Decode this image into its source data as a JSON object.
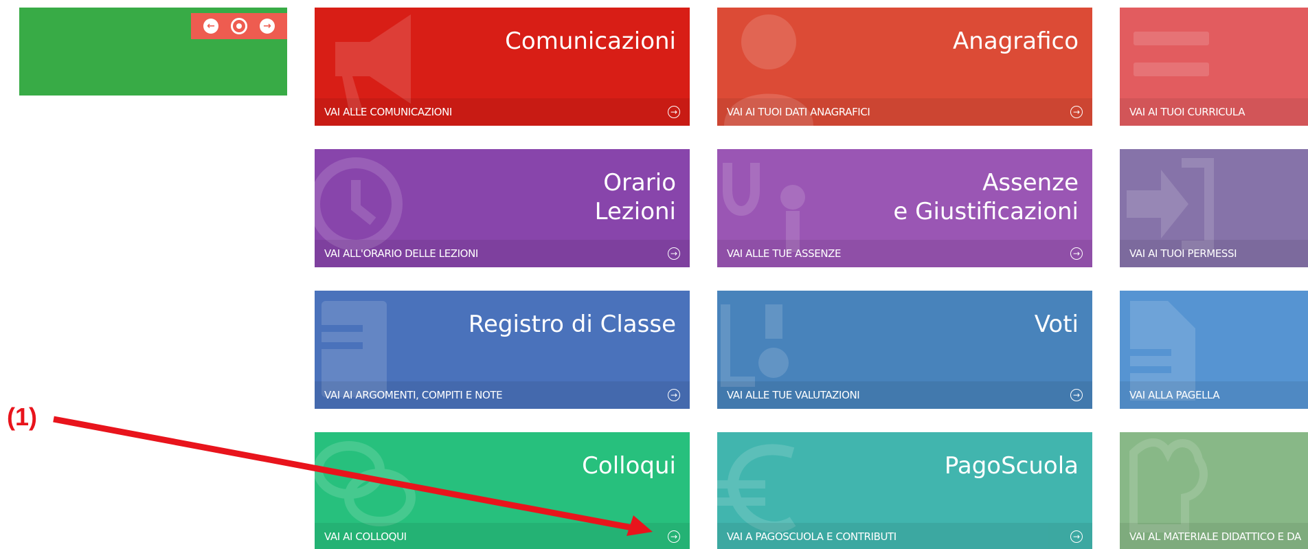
{
  "colors": {
    "widget_green": "#38ab46",
    "widget_controls": "#ee5c50",
    "annotation_red": "#e8141c"
  },
  "widget": {
    "controls": [
      {
        "icon": "arrow-left-icon",
        "glyph": "←"
      },
      {
        "icon": "target-icon",
        "glyph": ""
      },
      {
        "icon": "arrow-right-icon",
        "glyph": "→"
      }
    ]
  },
  "tiles": {
    "comunicazioni": {
      "title_lines": [
        "Comunicazioni"
      ],
      "link": "VAI ALLE COMUNICAZIONI",
      "color": "#d81e16",
      "icon": "megaphone-icon"
    },
    "anagrafico": {
      "title_lines": [
        "Anagrafico"
      ],
      "link": "VAI AI TUOI DATI ANAGRAFICI",
      "color": "#dc4b36",
      "icon": "person-icon"
    },
    "curricula": {
      "title_lines": [],
      "link": "VAI AI TUOI CURRICULA",
      "color": "#e25c5f",
      "icon": "list-icon"
    },
    "orario": {
      "title_lines": [
        "Orario",
        "Lezioni"
      ],
      "link": "VAI ALL'ORARIO DELLE LEZIONI",
      "color": "#8845ab",
      "icon": "clock-icon"
    },
    "assenze": {
      "title_lines": [
        "Assenze",
        "e Giustificazioni"
      ],
      "link": "VAI ALLE TUE ASSENZE",
      "color": "#9a56b4",
      "icon": "stethoscope-icon"
    },
    "permessi": {
      "title_lines": [],
      "link": "VAI AI TUOI PERMESSI",
      "color": "#8673a9",
      "icon": "enter-icon"
    },
    "registro": {
      "title_lines": [
        "Registro di Classe"
      ],
      "link": "VAI AI ARGOMENTI, COMPITI E NOTE",
      "color": "#4a72bb",
      "icon": "book-icon"
    },
    "voti": {
      "title_lines": [
        "Voti"
      ],
      "link": "VAI ALLE TUE VALUTAZIONI",
      "color": "#4883bb",
      "icon": "grades-icon"
    },
    "pagella": {
      "title_lines": [],
      "link": "VAI ALLA PAGELLA",
      "color": "#5694d2",
      "icon": "document-icon"
    },
    "colloqui": {
      "title_lines": [
        "Colloqui"
      ],
      "link": "VAI AI COLLOQUI",
      "color": "#27c07d",
      "icon": "chat-icon"
    },
    "pagoscuola": {
      "title_lines": [
        "PagoScuola"
      ],
      "link": "VAI A PAGOSCUOLA E CONTRIBUTI",
      "color": "#41b5ae",
      "icon": "euro-icon"
    },
    "materiale": {
      "title_lines": [],
      "link": "VAI AL MATERIALE DIDATTICO E DA",
      "color": "#88b887",
      "icon": "puzzle-icon"
    }
  },
  "annotation": {
    "label": "(1)"
  }
}
